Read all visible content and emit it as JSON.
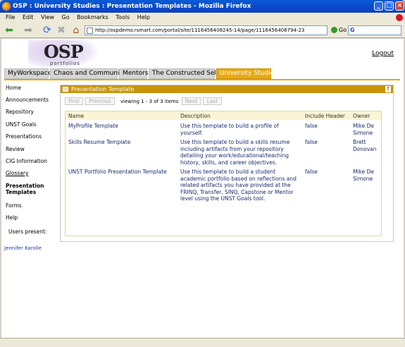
{
  "window": {
    "title": "OSP : University Studies : Presentation Templates - Mozilla Firefox"
  },
  "menu": [
    "File",
    "Edit",
    "View",
    "Go",
    "Bookmarks",
    "Tools",
    "Help"
  ],
  "address": {
    "url": "http://ospdemo.rsmart.com/portal/site/1116456408245-14/page/1116456408794-23",
    "go_label": "Go",
    "search_logo": "G"
  },
  "logo": {
    "text": "OSP",
    "sub": "portfolios"
  },
  "logout": "Logout",
  "tabs": [
    "MyWorkspace",
    "Chaos and Community",
    "Mentors",
    "The Constructed Self",
    "University Studies"
  ],
  "sidebar": {
    "items": [
      "Home",
      "Announcements",
      "Repository",
      "UNST Goals",
      "Presentations",
      "Review",
      "CIG Information",
      "Glossary",
      "Presentation Templates",
      "Forms",
      "Help"
    ],
    "users_present_label": "Users present:",
    "present_user": "Jennifer Karolle"
  },
  "panel": {
    "title": "Presentation Template",
    "help_label": "?",
    "pager": {
      "first": "First",
      "previous": "Previous",
      "next": "Next",
      "last": "Last",
      "viewing": "viewing 1 - 3 of 3 items"
    },
    "columns": [
      "Name",
      "Description",
      "Include Header",
      "Owner"
    ],
    "rows": [
      {
        "name": "MyProfile Template",
        "description": "Use this template to build a profile of yourself.",
        "include_header": "false",
        "owner": "Mike De Simone"
      },
      {
        "name": "Skills Resume Template",
        "description": "Use this template to build a skills resume including artifacts from your repository detailing your work/educational/teaching history, skills, and career objectives.",
        "include_header": "false",
        "owner": "Brett Donovan"
      },
      {
        "name": "UNST Portfolio Presentation Template",
        "description": "Use this template to build a student academic portfolio based on reflections and related artifacts you have provided at the FRINQ, Transfer, SINQ, Capstone or Mentor level using the UNST Goals tool.",
        "include_header": "false",
        "owner": "Mike De Simone"
      }
    ]
  }
}
